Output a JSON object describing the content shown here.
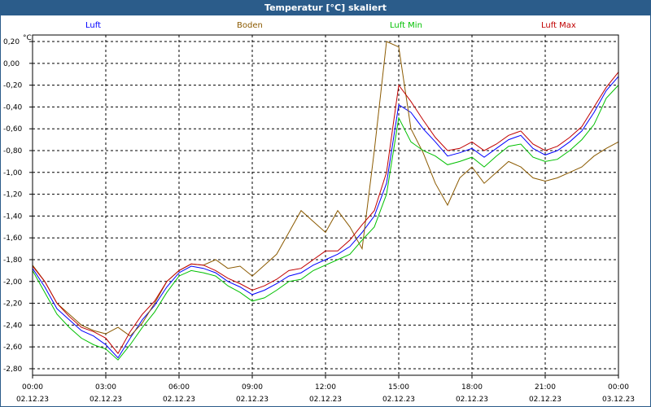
{
  "window": {
    "title": "Temperatur [°C] skaliert"
  },
  "chart_data": {
    "type": "line",
    "title": "Temperatur [°C] skaliert",
    "ylabel": "°C",
    "xlabel": "",
    "ylim": [
      -2.86,
      0.26
    ],
    "yticks": [
      0.2,
      0.0,
      -0.2,
      -0.4,
      -0.6,
      -0.8,
      -1.0,
      -1.2,
      -1.4,
      -1.6,
      -1.8,
      -2.0,
      -2.2,
      -2.4,
      -2.6,
      -2.8
    ],
    "ytick_labels": [
      "0,20",
      "0,00",
      "-0,20",
      "-0,40",
      "-0,60",
      "-0,80",
      "-1,00",
      "-1,20",
      "-1,40",
      "-1,60",
      "-1,80",
      "-2,00",
      "-2,20",
      "-2,40",
      "-2,60",
      "-2,80"
    ],
    "xlim": [
      "02.12.23 00:00",
      "03.12.23 00:00"
    ],
    "xticks": [
      {
        "time": "00:00",
        "date": "02.12.23"
      },
      {
        "time": "03:00",
        "date": "02.12.23"
      },
      {
        "time": "06:00",
        "date": "02.12.23"
      },
      {
        "time": "09:00",
        "date": "02.12.23"
      },
      {
        "time": "12:00",
        "date": "02.12.23"
      },
      {
        "time": "15:00",
        "date": "02.12.23"
      },
      {
        "time": "18:00",
        "date": "02.12.23"
      },
      {
        "time": "21:00",
        "date": "02.12.23"
      },
      {
        "time": "00:00",
        "date": "03.12.23"
      }
    ],
    "grid": true,
    "legend": "top",
    "x": [
      "00:00",
      "00:30",
      "01:00",
      "01:30",
      "02:00",
      "02:30",
      "03:00",
      "03:30",
      "04:00",
      "04:30",
      "05:00",
      "05:30",
      "06:00",
      "06:30",
      "07:00",
      "07:30",
      "08:00",
      "08:30",
      "09:00",
      "09:30",
      "10:00",
      "10:30",
      "11:00",
      "11:30",
      "12:00",
      "12:30",
      "13:00",
      "13:30",
      "14:00",
      "14:30",
      "15:00",
      "15:30",
      "16:00",
      "16:30",
      "17:00",
      "17:30",
      "18:00",
      "18:30",
      "19:00",
      "19:30",
      "20:00",
      "20:30",
      "21:00",
      "21:30",
      "22:00",
      "22:30",
      "23:00",
      "23:30",
      "00:00"
    ],
    "series": [
      {
        "name": "Luft",
        "color": "#0000ff",
        "values": [
          -1.88,
          -2.05,
          -2.25,
          -2.35,
          -2.45,
          -2.5,
          -2.58,
          -2.7,
          -2.52,
          -2.35,
          -2.22,
          -2.05,
          -1.92,
          -1.86,
          -1.88,
          -1.92,
          -2.0,
          -2.05,
          -2.12,
          -2.08,
          -2.02,
          -1.95,
          -1.92,
          -1.85,
          -1.8,
          -1.75,
          -1.68,
          -1.55,
          -1.4,
          -1.1,
          -0.38,
          -0.45,
          -0.6,
          -0.72,
          -0.85,
          -0.82,
          -0.78,
          -0.86,
          -0.78,
          -0.7,
          -0.66,
          -0.78,
          -0.84,
          -0.8,
          -0.72,
          -0.62,
          -0.45,
          -0.25,
          -0.12
        ]
      },
      {
        "name": "Boden",
        "color": "#8b5a00",
        "values": [
          -1.85,
          -2.0,
          -2.2,
          -2.3,
          -2.4,
          -2.45,
          -2.48,
          -2.42,
          -2.5,
          -2.38,
          -2.2,
          -2.0,
          -1.9,
          -1.84,
          -1.85,
          -1.8,
          -1.88,
          -1.86,
          -1.95,
          -1.85,
          -1.75,
          -1.55,
          -1.35,
          -1.45,
          -1.55,
          -1.35,
          -1.5,
          -1.7,
          -0.8,
          0.2,
          0.15,
          -0.6,
          -0.82,
          -1.1,
          -1.3,
          -1.05,
          -0.95,
          -1.1,
          -1.0,
          -0.9,
          -0.95,
          -1.05,
          -1.08,
          -1.05,
          -1.0,
          -0.95,
          -0.85,
          -0.78,
          -0.72
        ]
      },
      {
        "name": "Luft Min",
        "color": "#00c000",
        "values": [
          -1.9,
          -2.1,
          -2.3,
          -2.42,
          -2.52,
          -2.58,
          -2.62,
          -2.72,
          -2.58,
          -2.42,
          -2.28,
          -2.1,
          -1.95,
          -1.9,
          -1.92,
          -1.95,
          -2.04,
          -2.1,
          -2.18,
          -2.15,
          -2.08,
          -2.0,
          -1.98,
          -1.9,
          -1.85,
          -1.8,
          -1.75,
          -1.62,
          -1.5,
          -1.2,
          -0.5,
          -0.72,
          -0.8,
          -0.85,
          -0.93,
          -0.9,
          -0.86,
          -0.95,
          -0.85,
          -0.76,
          -0.74,
          -0.86,
          -0.9,
          -0.88,
          -0.8,
          -0.7,
          -0.56,
          -0.32,
          -0.2
        ]
      },
      {
        "name": "Luft Max",
        "color": "#c00000",
        "values": [
          -1.86,
          -2.0,
          -2.2,
          -2.32,
          -2.42,
          -2.46,
          -2.52,
          -2.66,
          -2.46,
          -2.3,
          -2.18,
          -2.0,
          -1.9,
          -1.84,
          -1.85,
          -1.9,
          -1.97,
          -2.02,
          -2.08,
          -2.04,
          -1.98,
          -1.9,
          -1.88,
          -1.8,
          -1.72,
          -1.72,
          -1.62,
          -1.48,
          -1.35,
          -1.0,
          -0.2,
          -0.35,
          -0.52,
          -0.68,
          -0.8,
          -0.78,
          -0.72,
          -0.8,
          -0.74,
          -0.66,
          -0.62,
          -0.74,
          -0.8,
          -0.76,
          -0.68,
          -0.58,
          -0.4,
          -0.22,
          -0.08
        ]
      }
    ]
  }
}
